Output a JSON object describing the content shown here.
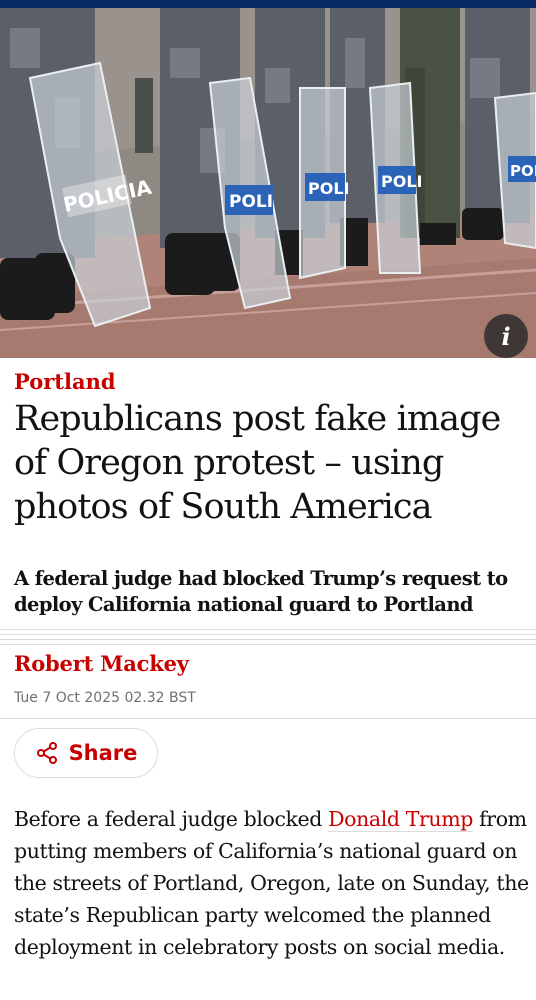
{
  "colors": {
    "brand_blue": "#052962",
    "accent_red": "#c70000",
    "text": "#121212",
    "muted": "#707070"
  },
  "image": {
    "info_label": "i",
    "shield_text_1": "POLICIA",
    "shield_text_2": "POLI",
    "shield_text_3": "POLI",
    "shield_text_4": "POLI",
    "shield_text_5": "POLI"
  },
  "article": {
    "kicker": "Portland",
    "headline": "Republicans post fake image of Oregon protest – using photos of South America",
    "standfirst": "A federal judge had blocked Trump’s request to deploy California national guard to Portland",
    "author": "Robert Mackey",
    "date": "Tue 7 Oct 2025 02.32 BST",
    "share_label": "Share",
    "body_before_link": "Before a federal judge blocked ",
    "body_link": "Donald Trump",
    "body_after_link": " from putting members of California’s national guard on the streets of Portland, Oregon, late on Sunday, the state’s Republican party welcomed the planned deployment in celebratory posts on social media."
  }
}
